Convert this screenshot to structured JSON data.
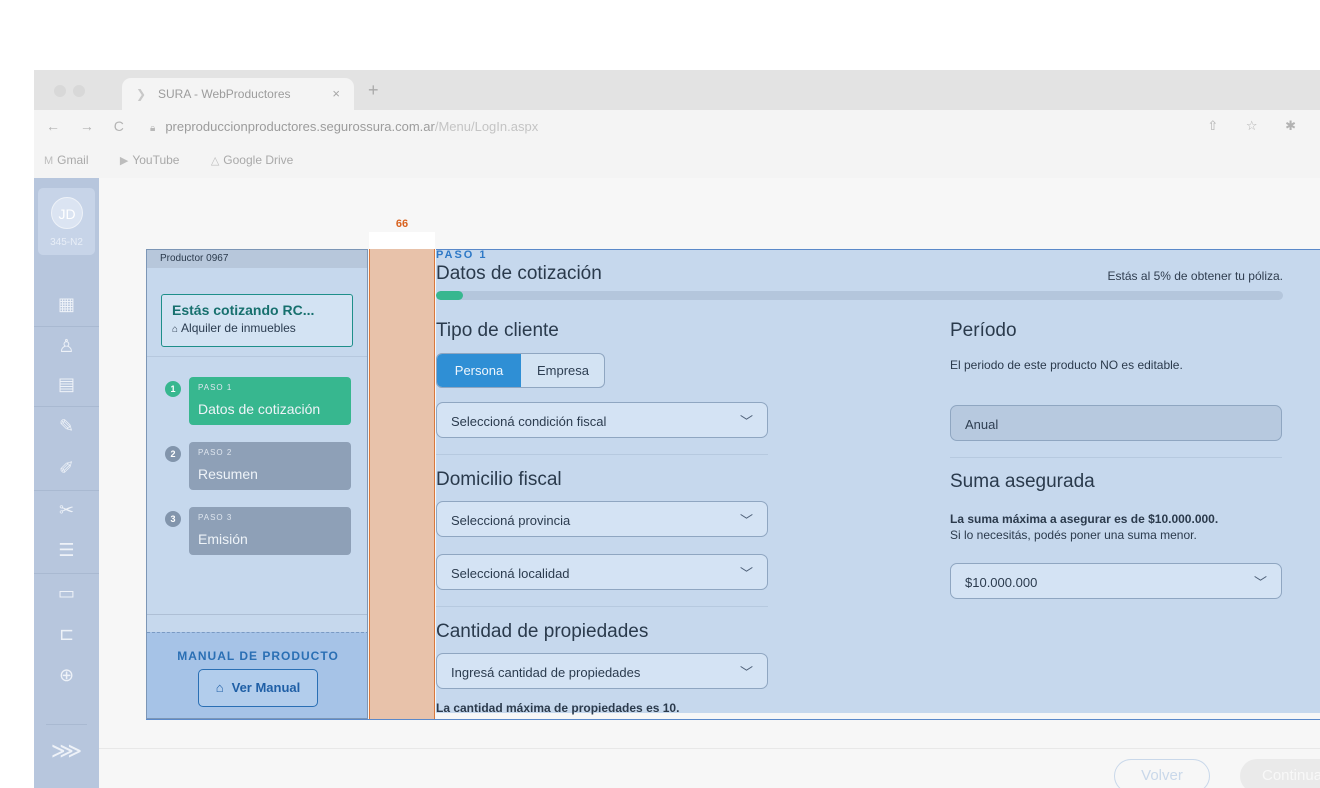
{
  "browser": {
    "tab_title": "SURA - WebProductores",
    "tab_close": "×",
    "new_tab": "+",
    "nav_icons": "← → C",
    "url_host": "preproduccionproductores.segurossura.com.ar",
    "url_path": "/Menu/LogIn.aspx",
    "tool_icons": "⇧ ☆ ✱",
    "bookmarks": [
      "Gmail",
      "YouTube",
      "Google Drive"
    ]
  },
  "user": {
    "initials": "JD",
    "code": "345-N2"
  },
  "sidebar_icons": [
    "dashboard-icon",
    "user-icon",
    "document-icon",
    "edit-document-icon",
    "edit-document-icon",
    "hands-icon",
    "clipboard-icon",
    "wallet-icon",
    "card-icon",
    "globe-hand-icon"
  ],
  "measure": {
    "label": "66"
  },
  "card": {
    "header": "Productor 0967",
    "quote_title": "Estás cotizando RC...",
    "quote_subtitle": "Alquiler de inmuebles",
    "steps": [
      {
        "num": "1",
        "label": "PASO 1",
        "name": "Datos de cotización",
        "active": true
      },
      {
        "num": "2",
        "label": "PASO 2",
        "name": "Resumen",
        "active": false
      },
      {
        "num": "3",
        "label": "PASO 3",
        "name": "Emisión",
        "active": false
      }
    ],
    "manual_title": "MANUAL DE PRODUCTO",
    "manual_button": "Ver Manual"
  },
  "form": {
    "step_label": "PASO 1",
    "title": "Datos de cotización",
    "progress_text": "Estás al 5% de obtener tu póliza.",
    "progress_percent": 5,
    "client_type": {
      "title": "Tipo de cliente",
      "options": [
        "Persona",
        "Empresa"
      ],
      "selected": "Persona"
    },
    "fiscal_condition": {
      "placeholder": "Seleccioná condición fiscal"
    },
    "fiscal_address": {
      "title": "Domicilio fiscal",
      "province_placeholder": "Seleccioná provincia",
      "locality_placeholder": "Seleccioná localidad"
    },
    "properties": {
      "title": "Cantidad de propiedades",
      "placeholder": "Ingresá cantidad de propiedades",
      "note": "La cantidad máxima de propiedades es 10."
    },
    "period": {
      "title": "Período",
      "note": "El periodo de este producto NO es editable.",
      "value": "Anual"
    },
    "sum_insured": {
      "title": "Suma asegurada",
      "note_bold": "La suma máxima a asegurar es de $10.000.000.",
      "note": "Si lo necesitás, podés poner una suma menor.",
      "value": "$10.000.000"
    }
  },
  "footer": {
    "back": "Volver",
    "continue": "Continuar"
  },
  "colors": {
    "accent_green": "#37b78f",
    "accent_blue": "#2f8fd5",
    "measure_orange": "#d9621f"
  }
}
